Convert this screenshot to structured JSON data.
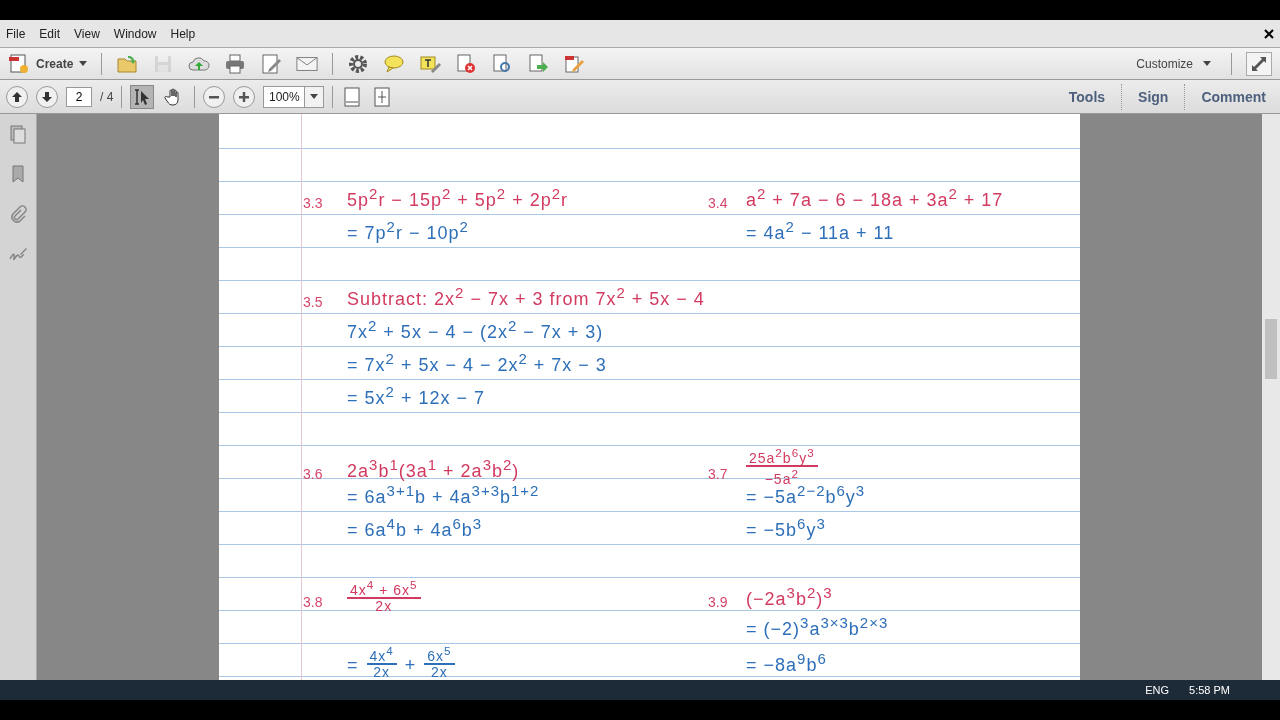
{
  "menu": [
    "File",
    "Edit",
    "View",
    "Window",
    "Help"
  ],
  "toolbar": {
    "create": "Create",
    "save": {
      "disabled": true
    },
    "customize": "Customize"
  },
  "nav": {
    "page": "2",
    "page_count": "/ 4",
    "zoom": "100%",
    "tools": [
      {
        "kind": "select",
        "selected": true
      },
      {
        "kind": "hand",
        "selected": false
      }
    ]
  },
  "panels": [
    "Tools",
    "Sign",
    "Comment"
  ],
  "page": {
    "blocks": [
      {
        "lines": [
          {
            "left": {
              "label": "3.3",
              "kind": "problem",
              "parts": [
                {
                  "kind": "text",
                  "s": "5p$^{2}$r − 15p$^{2}$ + 5p$^{2}$ + 2p$^{2}$r"
                }
              ]
            },
            "right": {
              "label": "3.4",
              "kind": "problem",
              "parts": [
                {
                  "kind": "text",
                  "s": "a$^{2}$ + 7a − 6 − 18a + 3a$^{2}$ + 17"
                }
              ]
            }
          },
          {
            "left": {
              "kind": "work",
              "parts": [
                {
                  "kind": "text",
                  "s": "= 7p$^{2}$r − 10p$^{2}$"
                }
              ]
            },
            "right": {
              "kind": "work",
              "parts": [
                {
                  "kind": "text",
                  "s": "= 4a$^{2}$ − 11a + 11"
                }
              ]
            }
          }
        ]
      },
      {
        "lines": [
          {
            "left": {
              "label": "3.5",
              "kind": "problem",
              "parts": [
                {
                  "kind": "text",
                  "s": "Subtract: 2x$^{2}$ − 7x + 3 from 7x$^{2}$ + 5x − 4"
                }
              ]
            }
          },
          {
            "left": {
              "kind": "work",
              "parts": [
                {
                  "kind": "text",
                  "s": "7x$^{2}$ + 5x − 4 − (2x$^{2}$ − 7x + 3)"
                }
              ]
            }
          },
          {
            "left": {
              "kind": "work",
              "parts": [
                {
                  "kind": "text",
                  "s": "= 7x$^{2}$ + 5x − 4 − 2x$^{2}$ + 7x − 3"
                }
              ]
            }
          },
          {
            "left": {
              "kind": "work",
              "parts": [
                {
                  "kind": "text",
                  "s": "= 5x$^{2}$ + 12x − 7"
                }
              ]
            }
          }
        ]
      },
      {
        "lines": [
          {
            "left": {
              "label": "3.6",
              "kind": "problem",
              "parts": [
                {
                  "kind": "text",
                  "s": "2a$^{3}$b$^{1}$(3a$^{1}$ + 2a$^{3}$b$^{2}$)"
                }
              ]
            },
            "right": {
              "label": "3.7",
              "kind": "problem",
              "parts": [
                {
                  "kind": "frac",
                  "num": "25a$^{2}$b$^{6}$y$^{3}$",
                  "den": "−5a$^{2}$"
                }
              ]
            }
          },
          {
            "left": {
              "kind": "work",
              "parts": [
                {
                  "kind": "text",
                  "s": "= 6a$^{3+1}$b + 4a$^{3+3}$b$^{1+2}$"
                }
              ]
            },
            "right": {
              "kind": "work",
              "parts": [
                {
                  "kind": "text",
                  "s": "= −5a$^{2−2}$b$^{6}$y$^{3}$"
                }
              ]
            }
          },
          {
            "left": {
              "kind": "work",
              "parts": [
                {
                  "kind": "text",
                  "s": "= 6a$^{4}$b + 4a$^{6}$b$^{3}$"
                }
              ]
            },
            "right": {
              "kind": "work",
              "parts": [
                {
                  "kind": "text",
                  "s": "= −5b$^{6}$y$^{3}$"
                }
              ]
            }
          }
        ]
      },
      {
        "lines": [
          {
            "left": {
              "label": "3.8",
              "kind": "problem",
              "parts": [
                {
                  "kind": "frac",
                  "num": "4x$^{4}$ + 6x$^{5}$",
                  "den": "2x"
                }
              ]
            },
            "right": {
              "label": "3.9",
              "kind": "problem",
              "parts": [
                {
                  "kind": "text",
                  "s": "(−2a$^{3}$b$^{2}$)$^{3}$"
                }
              ]
            }
          },
          {
            "right": {
              "kind": "work",
              "parts": [
                {
                  "kind": "text",
                  "s": "= (−2)$^{3}$a$^{3×3}$b$^{2×3}$"
                }
              ]
            }
          },
          {
            "left": {
              "kind": "work",
              "parts": [
                {
                  "kind": "text",
                  "s": "="
                },
                {
                  "kind": "frac",
                  "num": "4x$^{4}$",
                  "den": "2x"
                },
                {
                  "kind": "text",
                  "s": "+"
                },
                {
                  "kind": "frac",
                  "num": "6x$^{5}$",
                  "den": "2x"
                }
              ]
            },
            "right": {
              "kind": "work",
              "parts": [
                {
                  "kind": "text",
                  "s": "= −8a$^{9}$b$^{6}$"
                }
              ]
            }
          }
        ]
      }
    ]
  },
  "taskbar": {
    "language": "ENG",
    "time": "5:58 PM"
  }
}
